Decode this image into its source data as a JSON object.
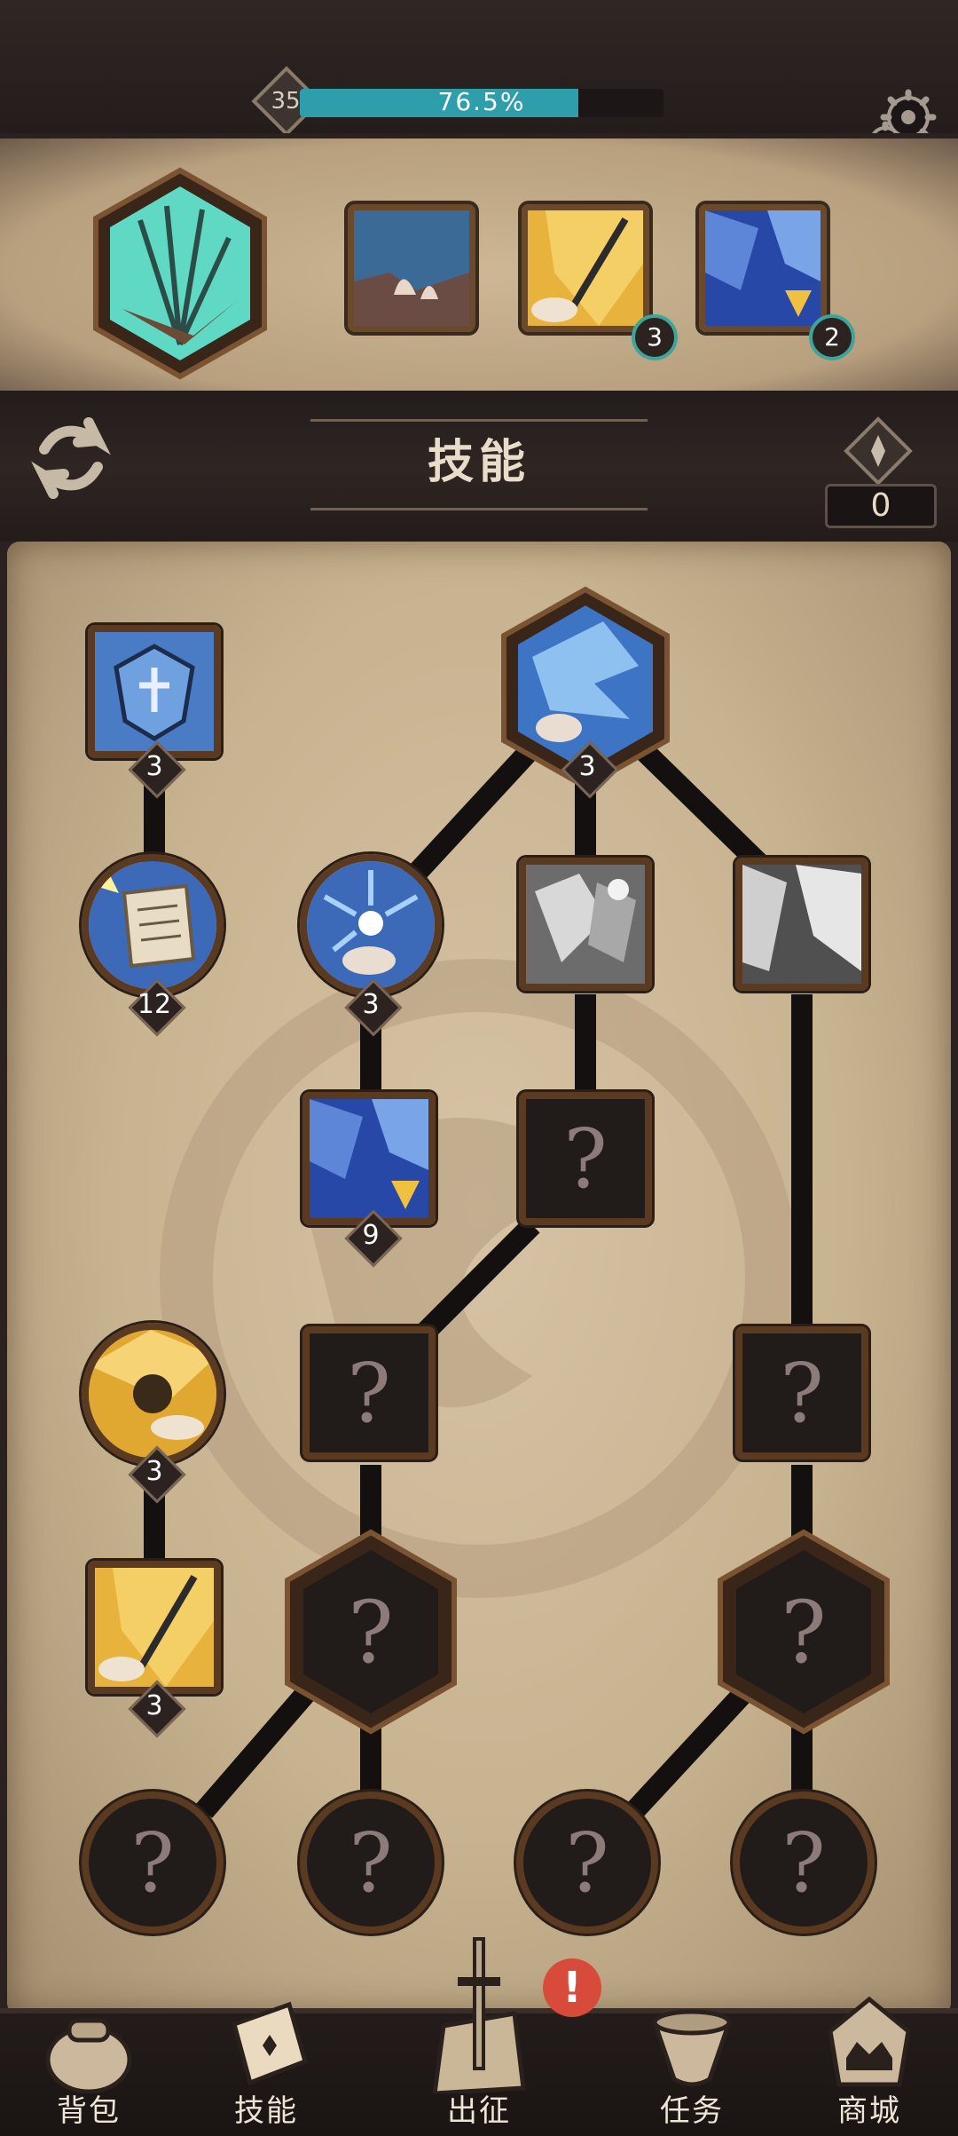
{
  "player": {
    "level": "35",
    "xp_percent_text": "76.5%",
    "xp_fraction": 0.765
  },
  "equipped": {
    "slot2_count": "3",
    "slot3_count": "2"
  },
  "title": {
    "text": "技能"
  },
  "gems": {
    "count": "0"
  },
  "tree": {
    "n1_level": "3",
    "n_top_level": "3",
    "n_scroll_level": "12",
    "n_orb_level": "3",
    "n_blue_level": "9",
    "n_gold_level": "3",
    "n_sword_level": "3"
  },
  "nav": {
    "bag": "背包",
    "skills": "技能",
    "expedition": "出征",
    "tasks": "任务",
    "shop": "商城",
    "alert": "!"
  },
  "colors": {
    "xp_bar": "#2d9eaa",
    "badge_ring": "#3fa59a",
    "alert": "#d84a3a",
    "parchment": "#c8b390"
  }
}
